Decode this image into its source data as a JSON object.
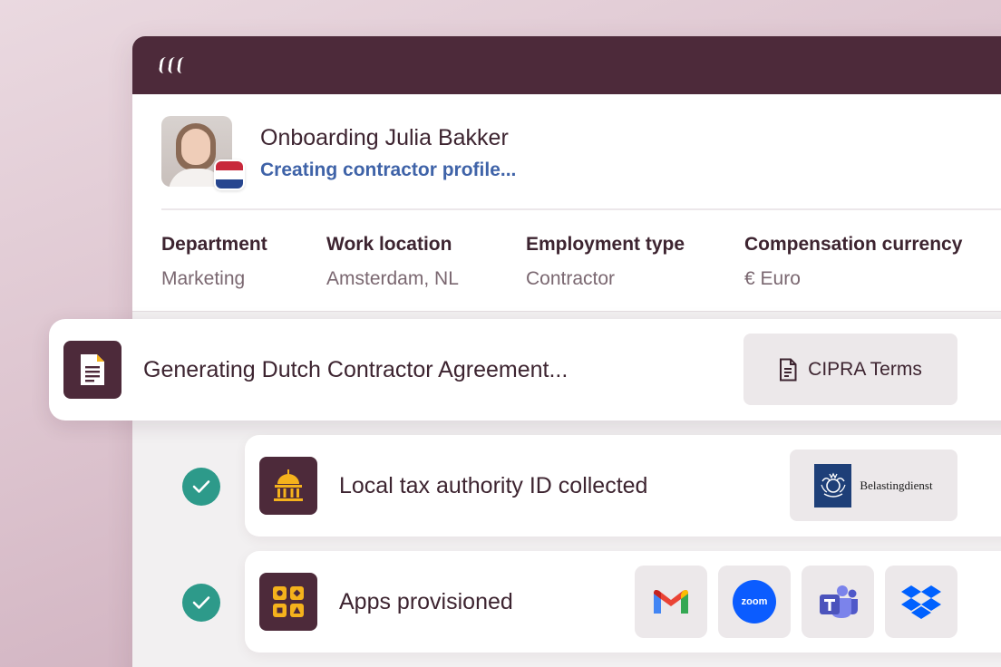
{
  "header": {
    "logo_icon": "rippling-logo-icon"
  },
  "onboarding": {
    "title": "Onboarding Julia Bakker",
    "status": "Creating contractor profile...",
    "country_flag": "netherlands-flag-icon"
  },
  "fields": [
    {
      "label": "Department",
      "value": "Marketing"
    },
    {
      "label": "Work location",
      "value": "Amsterdam, NL"
    },
    {
      "label": "Employment type",
      "value": "Contractor"
    },
    {
      "label": "Compensation currency",
      "value": "€ Euro"
    }
  ],
  "generating": {
    "title": "Generating Dutch Contractor Agreement...",
    "icon": "document-icon",
    "badge": "CIPRA Terms",
    "badge_icon": "file-icon"
  },
  "steps": [
    {
      "title": "Local tax authority ID collected",
      "icon": "government-building-icon",
      "status": "done",
      "partner": "Belastingdienst"
    },
    {
      "title": "Apps provisioned",
      "icon": "apps-grid-icon",
      "status": "done",
      "apps": [
        "Gmail",
        "Zoom",
        "Microsoft Teams",
        "Dropbox"
      ]
    }
  ],
  "apps": {
    "zoom_label": "zoom"
  },
  "colors": {
    "brand": "#4d2a3a",
    "accent": "#3f63a8",
    "success": "#2d9a8a",
    "icon_yellow": "#f5b21c"
  }
}
